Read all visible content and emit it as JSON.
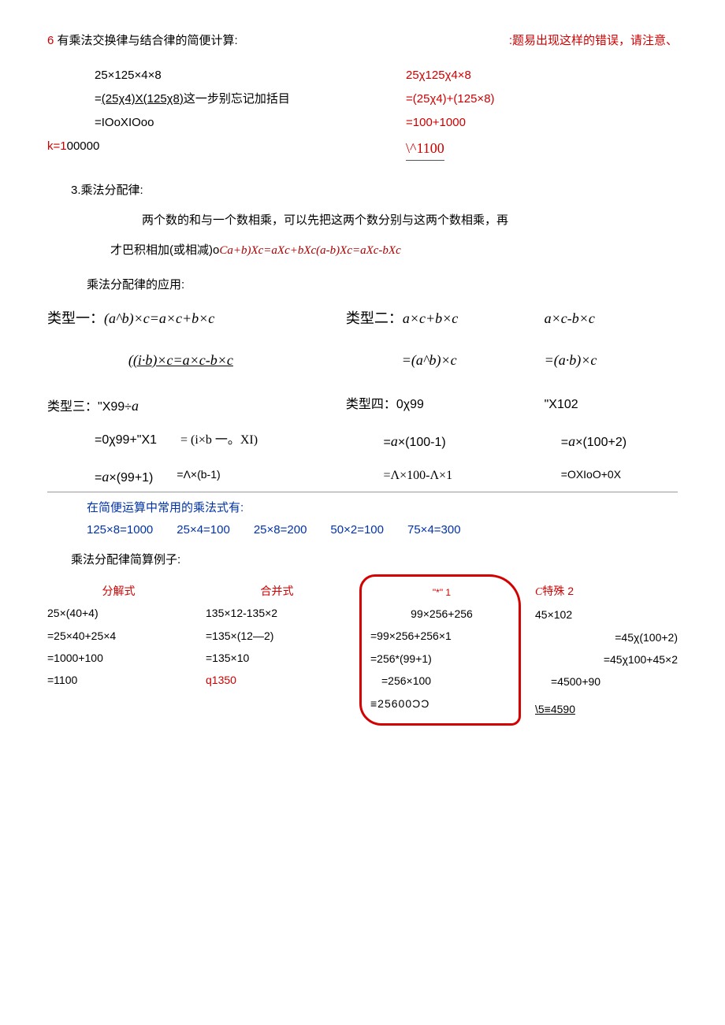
{
  "header": {
    "left_num": "6",
    "left_text": "有乘法交换律与结合律的简便计算:",
    "right_text": ":题易出现这样的错误，请注意、"
  },
  "leftcalc": {
    "l1": "25×125×4×8",
    "l2a": "=",
    "l2b": "(25χ4)X(125χ8)",
    "l2c": "这一步别忘记加括目",
    "l3": "=IOoXIOoo",
    "l4a": "k=1",
    "l4b": "00000"
  },
  "rightcalc": {
    "r1": "25χ125χ4×8",
    "r2": "=(25χ4)+(125×8)",
    "r3": "=100+1000",
    "r4": "\\^1100"
  },
  "sec3": {
    "title_num": "3.",
    "title_text": "乘法分配律:",
    "p1": "两个数的和与一个数相乘，可以先把这两个数分别与这两个数相乘，再",
    "p2a": "才巴积相加(或相减)o",
    "p2b": "Ca+b)Xc=aXc+bXc(a-b)Xc=aXc-bXc",
    "apps": "乘法分配律的应用:"
  },
  "types": {
    "t1_label": "类型一：",
    "t1_f1": "(a^b)×c=a×c+b×c",
    "t1_sub": "((i·b)×c=a×c-b×c",
    "t2_label": "类型二：",
    "t2_f1": "a×c+b×c",
    "t2_f2": "a×c-b×c",
    "t2_sub1": "=(a^b)×c",
    "t2_sub2": "=(a·b)×c",
    "t3_label": "类型三：",
    "t3_f1": "\"X99÷",
    "t3_f1b": "a",
    "t3_r1a": "=0χ99+\"X1",
    "t3_r1b": "= (i×b 一。XI)",
    "t3_r2a_pre": "=",
    "t3_r2a_mid": "a",
    "t3_r2a_suf": "×(99+1)",
    "t3_r2b": "=Λ×(b-1)",
    "t4_label": "类型四：",
    "t4_f1": "0χ99",
    "t4_f2": "\"X102",
    "t4_r1a_pre": "=",
    "t4_r1a_mid": "a",
    "t4_r1a_suf": "×(100-1)",
    "t4_r1b_pre": "=",
    "t4_r1b_mid": "a",
    "t4_r1b_suf": "×(100+2)",
    "t4_r2a": "=Λ×100-Λ×1",
    "t4_r2b": "=OXIoO+0X"
  },
  "facts": {
    "title": "在简便运算中常用的乘法式有:",
    "f1": "125×8=1000",
    "f2": "25×4=100",
    "f3": "25×8=200",
    "f4": "50×2=100",
    "f5": "75×4=300"
  },
  "examples": {
    "title": "乘法分配律简算例子:",
    "c1_h": "分解式",
    "c1_1": "25×(40+4)",
    "c1_2": "=25×40+25×4",
    "c1_3": "=1000+100",
    "c1_4": "=1100",
    "c2_h": "合并式",
    "c2_1": "135×12-135×2",
    "c2_2": "=135×(12—2)",
    "c2_3": "=135×10",
    "c2_4": "q1350",
    "c3_top_img": "\"*\"   1",
    "c3_1": "99×256+256",
    "c3_2": "=99×256+256×1",
    "c3_3": "=256*(99+1)",
    "c3_4": "=256×100",
    "c3_5": "≡25600ƆƆ",
    "c4_h_pre": "C",
    "c4_h": "特殊 2",
    "c4_1": "45×102",
    "c4_2": "=45χ(100+2)",
    "c4_3": "=45χ100+45×2",
    "c4_4": "=4500+90",
    "c4_5": "\\5≡4590"
  }
}
